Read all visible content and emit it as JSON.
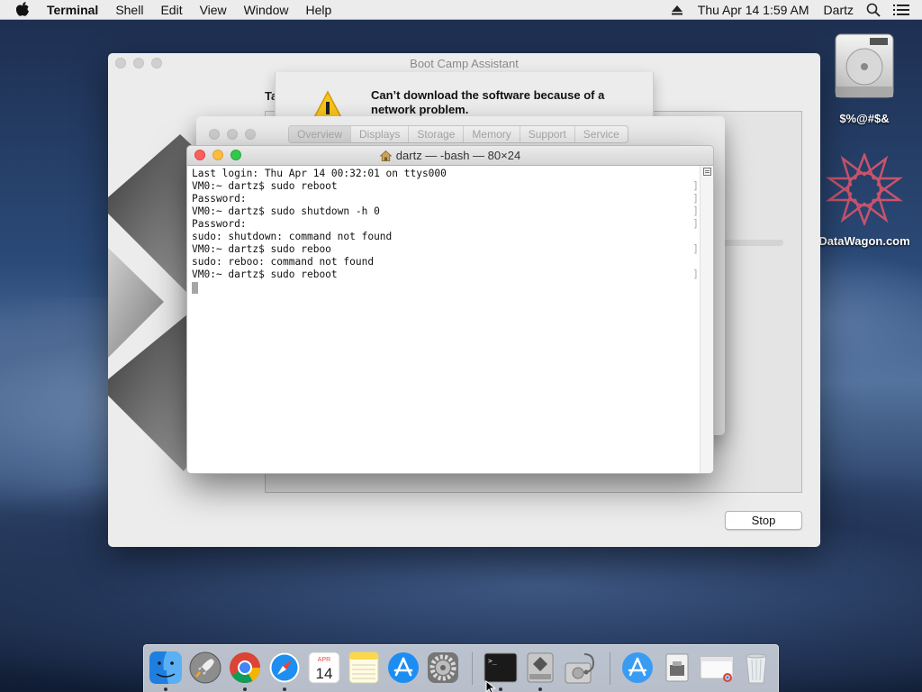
{
  "menubar": {
    "app_name": "Terminal",
    "items": [
      "Shell",
      "Edit",
      "View",
      "Window",
      "Help"
    ],
    "clock": "Thu Apr 14  1:59 AM",
    "user": "Dartz",
    "icons": [
      "apple-logo-icon",
      "eject-icon",
      "search-icon",
      "list-icon"
    ]
  },
  "desktop": {
    "disk_label": "$%@#$&",
    "site_label": "DataWagon.com"
  },
  "bootcamp": {
    "title": "Boot Camp Assistant",
    "heading_fragment": "Ta",
    "stop_label": "Stop"
  },
  "alert": {
    "message": "Can’t download the software because of a network problem."
  },
  "about_mac": {
    "tabs": [
      "Overview",
      "Displays",
      "Storage",
      "Memory",
      "Support",
      "Service"
    ],
    "selected_tab": "Overview"
  },
  "terminal": {
    "title": "dartz — -bash — 80×24",
    "lines": [
      "Last login: Thu Apr 14 00:32:01 on ttys000",
      "VM0:~ dartz$ sudo reboot",
      "Password:",
      "VM0:~ dartz$ sudo shutdown -h 0",
      "Password:",
      "sudo: shutdown: command not found",
      "VM0:~ dartz$ sudo reboo",
      "sudo: reboo: command not found",
      "VM0:~ dartz$ sudo reboot"
    ]
  },
  "dock": {
    "apps": [
      "Finder",
      "Launchpad",
      "Google Chrome",
      "Safari",
      "Calendar",
      "Notes",
      "App Store",
      "System Preferences",
      "Terminal",
      "Boot Camp Assistant",
      "Disk Utility",
      "Applications",
      "Downloads",
      "Chrome Window",
      "Trash"
    ],
    "calendar_month": "APR",
    "calendar_day": "14"
  },
  "colors": {
    "close": "#fc605c",
    "minimize": "#fdbc40",
    "zoom": "#34c84a",
    "menubar": "#ececec"
  }
}
